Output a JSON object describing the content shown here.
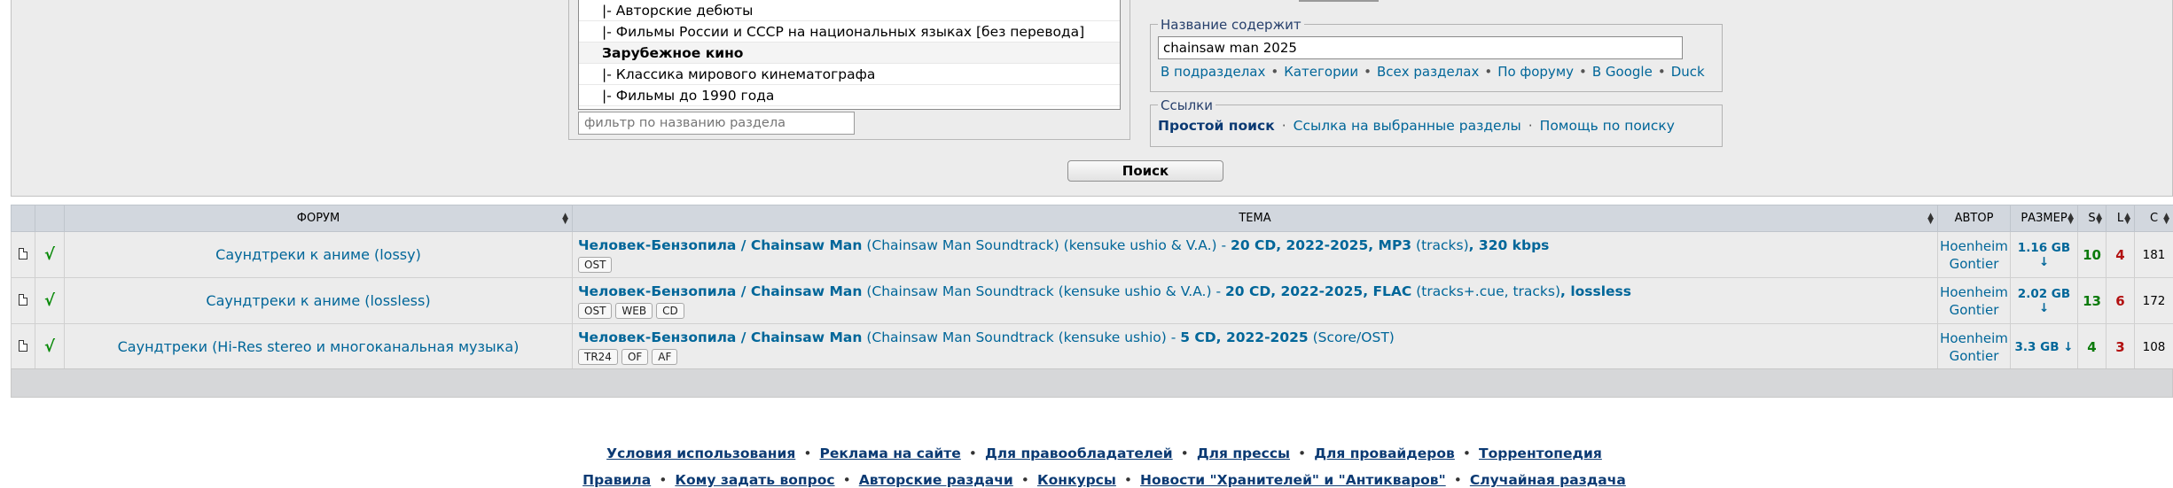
{
  "forum_select": {
    "options": [
      {
        "label": "|- Авторские дебюты",
        "type": "sub"
      },
      {
        "label": "|- Фильмы России и СССР на национальных языках [без перевода]",
        "type": "sub"
      },
      {
        "label": "Зарубежное кино",
        "type": "category"
      },
      {
        "label": "|- Классика мирового кинематографа",
        "type": "sub"
      },
      {
        "label": "|- Фильмы до 1990 года",
        "type": "sub"
      }
    ],
    "filter_placeholder": "фильтр по названию раздела"
  },
  "title_search": {
    "legend": "Название содержит",
    "value": "chainsaw man 2025",
    "links": [
      "В подразделах",
      "Категории",
      "Всех разделах",
      "По форуму",
      "В Google",
      "Duck"
    ],
    "separator": "•"
  },
  "links_box": {
    "legend": "Ссылки",
    "simple_search": "Простой поиск",
    "selected_sections": "Ссылка на выбранные разделы",
    "help": "Помощь по поиску",
    "separator": "·"
  },
  "search_button": "Поиск",
  "table": {
    "headers": {
      "forum": "ФОРУМ",
      "topic": "ТЕМА",
      "author": "АВТОР",
      "size": "РАЗМЕР",
      "seeds": "S",
      "leeches": "L",
      "completed": "C"
    },
    "check_glyph": "√",
    "rows": [
      {
        "forum": "Саундтреки к аниме (lossy)",
        "title_main": "Человек-Бензопила / Chainsaw Man",
        "title_mid": " (Chainsaw Man Soundtrack) (kensuke ushio & V.A.) - ",
        "title_bold": "20 CD, 2022-2025, MP3",
        "title_tail": " (tracks)",
        "title_end": ", 320 kbps",
        "tags": [
          "OST"
        ],
        "author_line1": "Hoenheim",
        "author_line2": "Gontier",
        "size": "1.16 GB ↓",
        "seeds": "10",
        "leeches": "4",
        "completed": "181"
      },
      {
        "forum": "Саундтреки к аниме (lossless)",
        "title_main": "Человек-Бензопила / Chainsaw Man",
        "title_mid": " (Chainsaw Man Soundtrack (kensuke ushio & V.A.) - ",
        "title_bold": "20 CD, 2022-2025, FLAC",
        "title_tail": " (tracks+.cue, tracks)",
        "title_end": ", lossless",
        "tags": [
          "OST",
          "WEB",
          "CD"
        ],
        "author_line1": "Hoenheim",
        "author_line2": "Gontier",
        "size": "2.02 GB ↓",
        "seeds": "13",
        "leeches": "6",
        "completed": "172"
      },
      {
        "forum": "Саундтреки (Hi-Res stereo и многоканальная музыка)",
        "title_main": "Человек-Бензопила / Chainsaw Man",
        "title_mid": " (Chainsaw Man Soundtrack (kensuke ushio) - ",
        "title_bold": "5 CD, 2022-2025",
        "title_tail": " (Score/OST)",
        "title_end": "",
        "tags": [
          "TR24",
          "OF",
          "AF"
        ],
        "author_line1": "Hoenheim",
        "author_line2": "Gontier",
        "size": "3.3 GB ↓",
        "seeds": "4",
        "leeches": "3",
        "completed": "108"
      }
    ]
  },
  "footer": {
    "row1": [
      "Условия использования",
      "Реклама на сайте",
      "Для правообладателей",
      "Для прессы",
      "Для провайдеров",
      "Торрентопедия"
    ],
    "row2": [
      "Правила",
      "Кому задать вопрос",
      "Авторские раздачи",
      "Конкурсы",
      "Новости \"Хранителей\" и \"Антикваров\"",
      "Случайная раздача"
    ],
    "separator": "•"
  },
  "colors": {
    "link": "#006699",
    "panel_bg": "#ececec",
    "header_bg": "#d2d7de",
    "seed": "#0a7a0a",
    "leech": "#b21010"
  },
  "icons": {
    "file": "file-icon",
    "check": "check-icon",
    "sort": "sort-arrows-icon"
  }
}
